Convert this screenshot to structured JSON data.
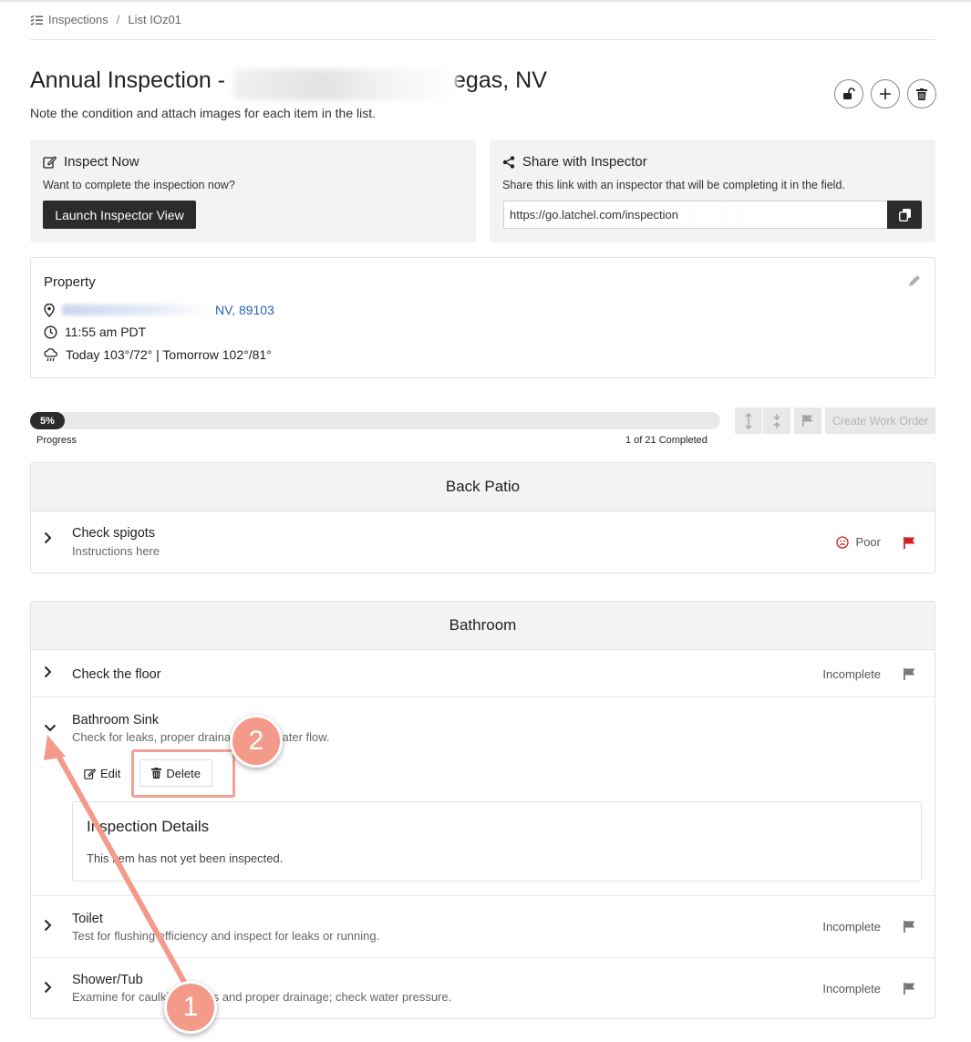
{
  "breadcrumb": {
    "root": "Inspections",
    "separator": "/",
    "current": "List IOz01"
  },
  "header": {
    "title": "Annual Inspection -",
    "title_suffix": "egas, NV",
    "subtitle": "Note the condition and attach images for each item in the list.",
    "actions": [
      "unlock-icon",
      "plus-icon",
      "trash-icon"
    ]
  },
  "inspect_now": {
    "title": "Inspect Now",
    "text": "Want to complete the inspection now?",
    "button": "Launch Inspector View"
  },
  "share": {
    "title": "Share with Inspector",
    "text": "Share this link with an inspector that will be completing it in the field.",
    "link": "https://go.latchel.com/inspection"
  },
  "property": {
    "title": "Property",
    "address_visible": "NV, 89103",
    "time": "11:55 am PDT",
    "weather": "Today 103°/72° | Tomorrow 102°/81°"
  },
  "progress": {
    "percent_label": "5%",
    "percent": 5,
    "label": "Progress",
    "count": "1 of 21 Completed",
    "create_work_order": "Create Work Order"
  },
  "sections": [
    {
      "title": "Back Patio",
      "items": [
        {
          "title": "Check spigots",
          "subtitle": "Instructions here",
          "status": "Poor",
          "flag_color": "#d32020"
        }
      ]
    },
    {
      "title": "Bathroom",
      "items": [
        {
          "title": "Check the floor",
          "subtitle": "",
          "status": "Incomplete",
          "flag_color": "#777777"
        },
        {
          "title": "Bathroom Sink",
          "subtitle": "Check for leaks, proper drainage, and water flow.",
          "status": "",
          "expanded": true
        },
        {
          "title": "Toilet",
          "subtitle": "Test for flushing efficiency and inspect for leaks or running.",
          "status": "Incomplete",
          "flag_color": "#777777"
        },
        {
          "title": "Shower/Tub",
          "subtitle": "Examine for caulking issues and proper drainage; check water pressure.",
          "status": "Incomplete",
          "flag_color": "#777777"
        }
      ]
    }
  ],
  "expanded_item": {
    "edit": "Edit",
    "delete": "Delete",
    "details_title": "Inspection Details",
    "details_text": "This item has not yet been inspected."
  },
  "annotations": {
    "badge_1": "1",
    "badge_2": "2",
    "color": "#f39a8b"
  }
}
